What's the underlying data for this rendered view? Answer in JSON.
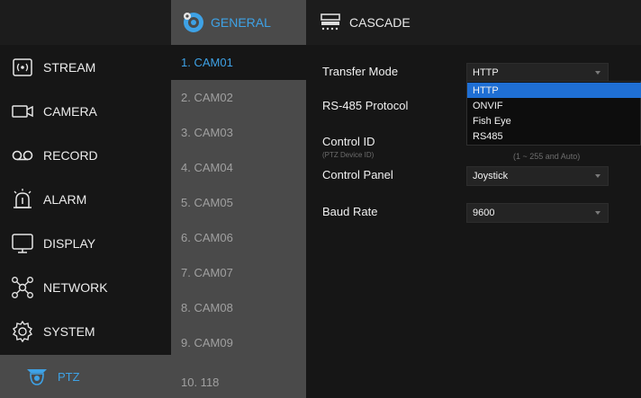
{
  "tabs": [
    {
      "label": "GENERAL",
      "active": true,
      "icon": "gear-blue-icon"
    },
    {
      "label": "CASCADE",
      "active": false,
      "icon": "cascade-icon"
    }
  ],
  "sidebar": {
    "items": [
      {
        "label": "STREAM",
        "icon": "stream-icon"
      },
      {
        "label": "CAMERA",
        "icon": "camera-icon"
      },
      {
        "label": "RECORD",
        "icon": "record-icon"
      },
      {
        "label": "ALARM",
        "icon": "alarm-icon"
      },
      {
        "label": "DISPLAY",
        "icon": "display-icon"
      },
      {
        "label": "NETWORK",
        "icon": "network-icon"
      },
      {
        "label": "SYSTEM",
        "icon": "system-icon"
      }
    ],
    "active": {
      "label": "PTZ",
      "icon": "ptz-camera-icon"
    }
  },
  "channels": [
    "1. CAM01",
    "2. CAM02",
    "3. CAM03",
    "4. CAM04",
    "5. CAM05",
    "6. CAM06",
    "7. CAM07",
    "8. CAM08",
    "9. CAM09",
    "10. 118"
  ],
  "settings": {
    "transfer_mode": {
      "label": "Transfer Mode",
      "value": "HTTP"
    },
    "rs485_protocol": {
      "label": "RS-485 Protocol"
    },
    "control_id": {
      "label": "Control ID",
      "sublabel": "(PTZ Device ID)",
      "hint": "(1 ~ 255 and Auto)"
    },
    "control_panel": {
      "label": "Control Panel",
      "value": "Joystick"
    },
    "baud_rate": {
      "label": "Baud Rate",
      "value": "9600"
    }
  },
  "dropdown": {
    "options": [
      "HTTP",
      "ONVIF",
      "Fish Eye",
      "RS485"
    ],
    "highlighted": "HTTP"
  },
  "colors": {
    "accent": "#3ea2e6",
    "highlight": "#1f6fd4",
    "panel_gray": "#4a4a4a",
    "background": "#161616"
  }
}
